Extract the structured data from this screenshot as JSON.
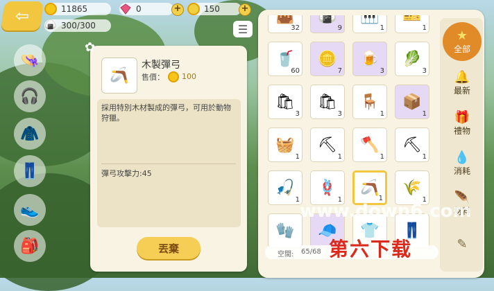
{
  "currency": {
    "coins": "11865",
    "gems": "0",
    "tokens": "150",
    "stamina": "300/300"
  },
  "item": {
    "name": "木製彈弓",
    "price_label": "售價：",
    "price": "100",
    "description": "採用特別木材製成的彈弓，可用於動物狩獵。",
    "stat": "彈弓攻擊力:45"
  },
  "drop_label": "丟棄",
  "capacity": {
    "label": "空間:",
    "value": "65/68"
  },
  "tabs": [
    {
      "label": "全部",
      "icon": "star-icon"
    },
    {
      "label": "最新",
      "icon": "bell-icon"
    },
    {
      "label": "禮物",
      "icon": "gift-icon"
    },
    {
      "label": "消耗",
      "icon": "drop-icon"
    },
    {
      "label": "材料",
      "icon": "feather-icon"
    },
    {
      "label": "",
      "icon": "pencil-icon"
    }
  ],
  "inventory": [
    {
      "glyph": "👜",
      "qty": "32",
      "purple": false
    },
    {
      "glyph": "🍙",
      "qty": "9",
      "purple": true
    },
    {
      "glyph": "🎹",
      "qty": "1",
      "purple": false
    },
    {
      "glyph": "🎫",
      "qty": "1",
      "purple": false
    },
    {
      "glyph": "🥤",
      "qty": "60",
      "purple": false
    },
    {
      "glyph": "🪙",
      "qty": "7",
      "purple": true
    },
    {
      "glyph": "🍺",
      "qty": "3",
      "purple": true
    },
    {
      "glyph": "🥬",
      "qty": "3",
      "purple": false
    },
    {
      "glyph": "🛍",
      "qty": "3",
      "purple": false
    },
    {
      "glyph": "🛍",
      "qty": "3",
      "purple": false
    },
    {
      "glyph": "🪑",
      "qty": "1",
      "purple": false
    },
    {
      "glyph": "📦",
      "qty": "1",
      "purple": true
    },
    {
      "glyph": "🧺",
      "qty": "1",
      "purple": false
    },
    {
      "glyph": "⛏",
      "qty": "1",
      "purple": false
    },
    {
      "glyph": "🪓",
      "qty": "1",
      "purple": false
    },
    {
      "glyph": "⛏",
      "qty": "1",
      "purple": false
    },
    {
      "glyph": "🎣",
      "qty": "1",
      "purple": false
    },
    {
      "glyph": "🪢",
      "qty": "1",
      "purple": false
    },
    {
      "glyph": "🪃",
      "qty": "1",
      "purple": false,
      "sel": true
    },
    {
      "glyph": "🌾",
      "qty": "1",
      "purple": false
    },
    {
      "glyph": "🧤",
      "qty": "",
      "purple": false
    },
    {
      "glyph": "🧢",
      "qty": "",
      "purple": true
    },
    {
      "glyph": "👕",
      "qty": "",
      "purple": false
    },
    {
      "glyph": "👖",
      "qty": "",
      "purple": false
    }
  ],
  "watermark": {
    "site": "www.down6.com",
    "name": "第六下载"
  }
}
